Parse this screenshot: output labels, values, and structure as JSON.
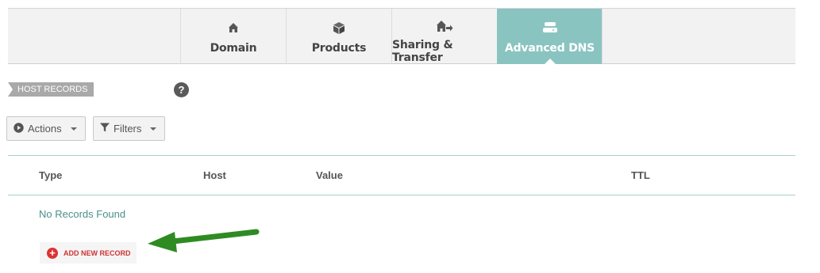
{
  "tabs": [
    {
      "label": "Domain",
      "icon": "house-icon",
      "active": false
    },
    {
      "label": "Products",
      "icon": "box-icon",
      "active": false
    },
    {
      "label": "Sharing & Transfer",
      "icon": "house-transfer-icon",
      "active": false
    },
    {
      "label": "Advanced DNS",
      "icon": "server-stack-icon",
      "active": true
    }
  ],
  "section": {
    "title": "HOST RECORDS",
    "help_label": "?"
  },
  "toolbar": {
    "actions_label": "Actions",
    "filters_label": "Filters"
  },
  "table": {
    "columns": [
      "Type",
      "Host",
      "Value",
      "TTL"
    ],
    "empty_message": "No Records Found"
  },
  "add_record": {
    "label": "ADD NEW RECORD"
  },
  "colors": {
    "active_tab": "#8ac4c1",
    "table_rule": "#a8cfcc",
    "empty_text": "#4a8f8b",
    "add_record": "#dd3333",
    "annotation_arrow": "#2e8b22"
  }
}
